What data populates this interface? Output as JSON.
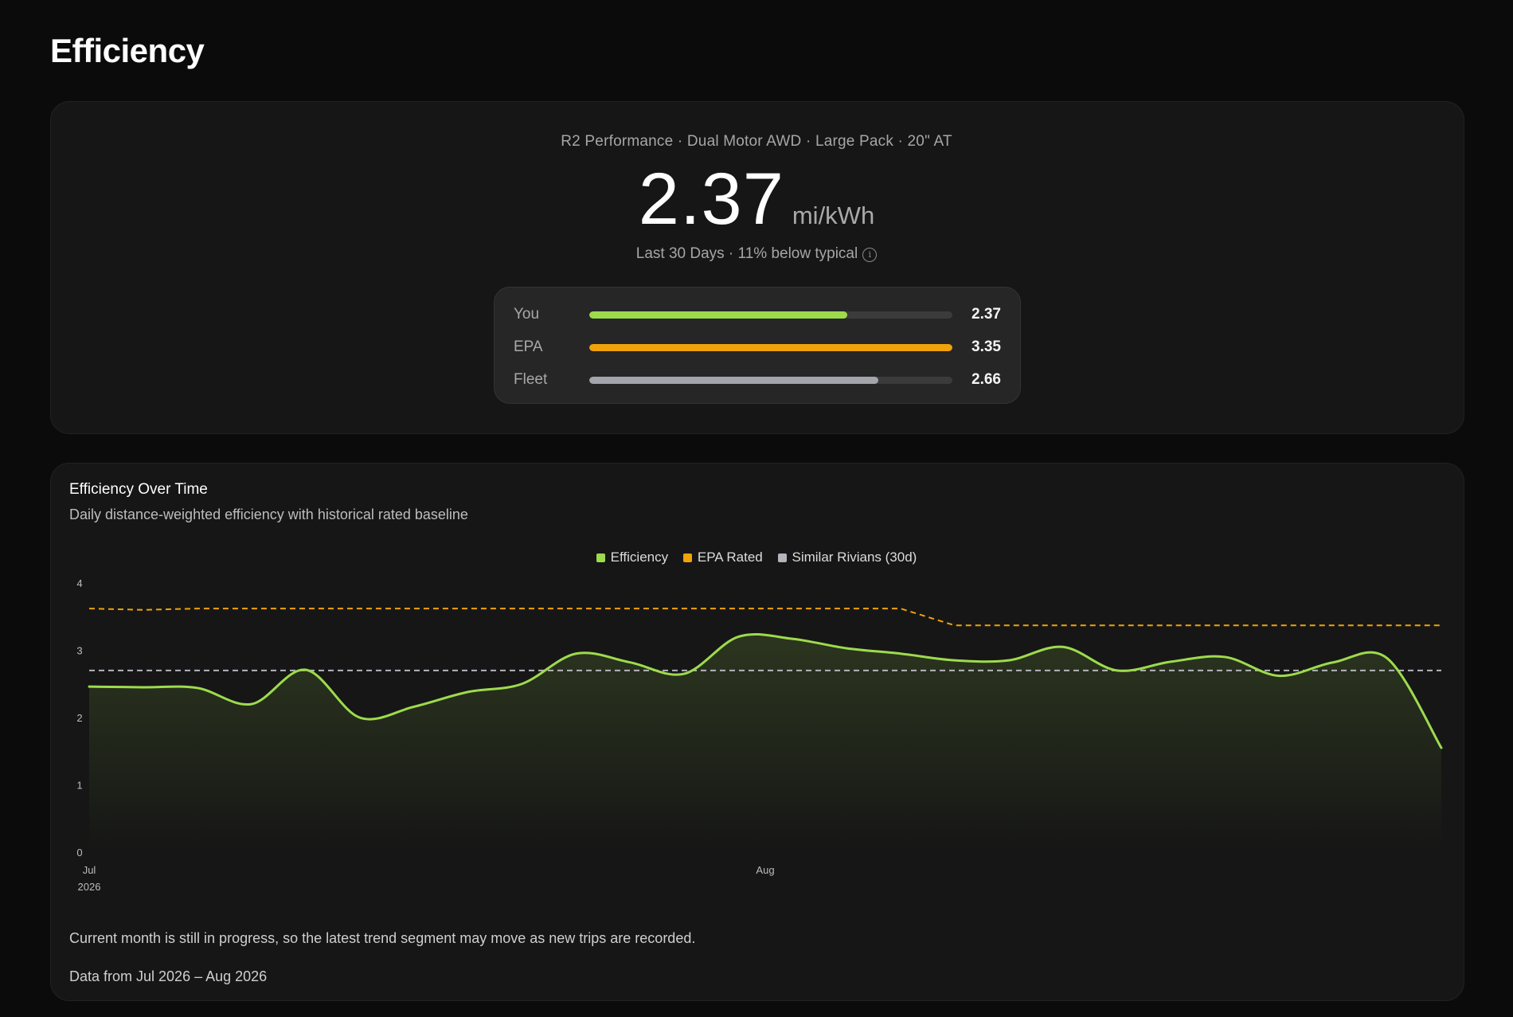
{
  "page": {
    "title": "Efficiency"
  },
  "summary": {
    "vehicle": "R2 Performance · Dual Motor AWD · Large Pack · 20\" AT",
    "value": "2.37",
    "unit": "mi/kWh",
    "period": "Last 30 Days · 11% below typical",
    "comparison": [
      {
        "label": "You",
        "value": "2.37",
        "fraction": 0.71,
        "color": "#9ddb4d"
      },
      {
        "label": "EPA",
        "value": "3.35",
        "fraction": 1.0,
        "color": "#f0a20c"
      },
      {
        "label": "Fleet",
        "value": "2.66",
        "fraction": 0.795,
        "color": "#a4a4ac"
      }
    ]
  },
  "chart_card": {
    "title": "Efficiency Over Time",
    "subtitle": "Daily distance-weighted efficiency with historical rated baseline",
    "note": "Current month is still in progress, so the latest trend segment may move as new trips are recorded.",
    "range": "Data from Jul 2026 – Aug 2026"
  },
  "chart_data": {
    "type": "line",
    "x_start_label": [
      "Jul",
      "2026"
    ],
    "x_mid_label": "Aug",
    "ylim": [
      0,
      4
    ],
    "yticks": [
      "0",
      "1",
      "2",
      "3",
      "4"
    ],
    "legend_position": "top-center",
    "grid": false,
    "series": [
      {
        "name": "Efficiency",
        "color": "#9ddb4d",
        "style": "solid-area",
        "values": [
          2.46,
          2.45,
          2.44,
          2.2,
          2.71,
          2.0,
          2.16,
          2.38,
          2.5,
          2.95,
          2.82,
          2.65,
          3.2,
          3.17,
          3.03,
          2.95,
          2.85,
          2.85,
          3.05,
          2.7,
          2.83,
          2.9,
          2.62,
          2.82,
          2.88,
          1.55
        ]
      },
      {
        "name": "EPA Rated",
        "color": "#f0a20c",
        "style": "dashed",
        "values": [
          3.62,
          3.6,
          3.62,
          3.62,
          3.62,
          3.62,
          3.62,
          3.62,
          3.62,
          3.62,
          3.62,
          3.62,
          3.62,
          3.62,
          3.62,
          3.62,
          3.37,
          3.37,
          3.37,
          3.37,
          3.37,
          3.37,
          3.37,
          3.37,
          3.37,
          3.37
        ]
      },
      {
        "name": "Similar Rivians (30d)",
        "color": "#b4b4bc",
        "style": "dashed",
        "values": [
          2.7,
          2.7,
          2.7,
          2.7,
          2.7,
          2.7,
          2.7,
          2.7,
          2.7,
          2.7,
          2.7,
          2.7,
          2.7,
          2.7,
          2.7,
          2.7,
          2.7,
          2.7,
          2.7,
          2.7,
          2.7,
          2.7,
          2.7,
          2.7,
          2.7,
          2.7
        ]
      }
    ]
  }
}
